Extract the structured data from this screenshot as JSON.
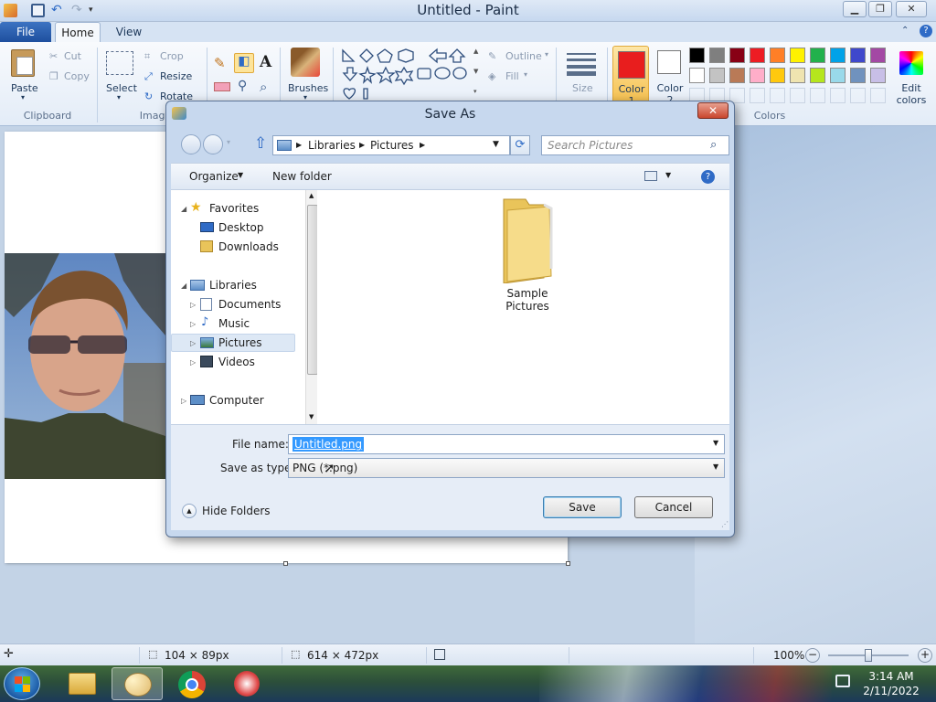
{
  "window": {
    "title": "Untitled - Paint"
  },
  "ribbon": {
    "tabs": [
      "File",
      "Home",
      "View"
    ],
    "clipboard": {
      "paste": "Paste",
      "cut": "Cut",
      "copy": "Copy",
      "group": "Clipboard"
    },
    "image": {
      "select": "Select",
      "crop": "Crop",
      "resize": "Resize",
      "rotate": "Rotate",
      "group": "Image"
    },
    "brushes": "Brushes",
    "shapes": {
      "outline": "Outline",
      "fill": "Fill"
    },
    "size": "Size",
    "colors": {
      "color1": "Color 1",
      "color2": "Color 2",
      "edit": "Edit colors",
      "group": "Colors",
      "color1_value": "#e81e1e",
      "color2_value": "#ffffff",
      "palette_row1": [
        "#000000",
        "#7f7f7f",
        "#880015",
        "#ed1c24",
        "#ff7f27",
        "#fff200",
        "#22b14c",
        "#00a2e8",
        "#3f48cc",
        "#a349a4"
      ],
      "palette_row2": [
        "#ffffff",
        "#c3c3c3",
        "#b97a57",
        "#ffaec9",
        "#ffc90e",
        "#efe4b0",
        "#b5e61d",
        "#99d9ea",
        "#7092be",
        "#c8bfe7"
      ]
    }
  },
  "dialog": {
    "title": "Save As",
    "breadcrumb": [
      "Libraries",
      "Pictures"
    ],
    "search_placeholder": "Search Pictures",
    "toolbar": {
      "organize": "Organize",
      "new_folder": "New folder"
    },
    "nav": {
      "favorites": "Favorites",
      "desktop": "Desktop",
      "downloads": "Downloads",
      "libraries": "Libraries",
      "documents": "Documents",
      "music": "Music",
      "pictures": "Pictures",
      "videos": "Videos",
      "computer": "Computer"
    },
    "folder": "Sample Pictures",
    "file_name_label": "File name:",
    "file_name_value": "Untitled.png",
    "save_type_label": "Save as type:",
    "save_type_value": "PNG (*.png)",
    "hide_folders": "Hide Folders",
    "save": "Save",
    "cancel": "Cancel"
  },
  "status": {
    "selection_size": "104 × 89px",
    "canvas_size": "614 × 472px",
    "zoom": "100%"
  },
  "taskbar": {
    "time": "3:14 AM",
    "date": "2/11/2022"
  }
}
